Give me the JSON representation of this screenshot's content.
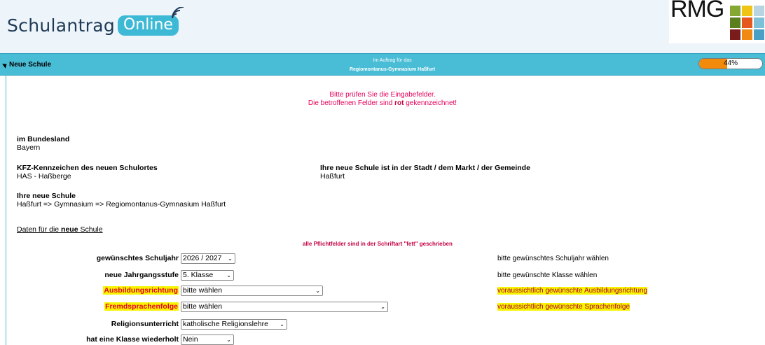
{
  "header": {
    "logo_word": "Schulantrag",
    "logo_pill": "Online",
    "school_logo_text": "RMG",
    "school_logo_colors": [
      "#85a832",
      "#f0c414",
      "#b7d4e0",
      "#5a7f1c",
      "#e55a1c",
      "#7ec0d8",
      "#7a1c1c",
      "#f08a14",
      "#4aa0c4"
    ]
  },
  "nav": {
    "title": "Neue Schule",
    "center_line1": "Im Auftrag für das",
    "center_line2": "Regiomontanus-Gymnasium Haßfurt",
    "progress_percent": 44,
    "progress_label": "44%"
  },
  "alert": {
    "line1": "Bitte prüfen Sie die Eingabefelder.",
    "line2_prefix": "Die betroffenen Felder sind ",
    "line2_bold": "rot",
    "line2_suffix": " gekennzeichnet!"
  },
  "info": {
    "bundesland_label": "im Bundesland",
    "bundesland_value": "Bayern",
    "kfz_label": "KFZ-Kennzeichen des neuen Schulortes",
    "kfz_value": "HAS - Haßberge",
    "stadt_label": "Ihre neue Schule ist in der Stadt / dem Markt / der Gemeinde",
    "stadt_value": "Haßfurt",
    "schule_label": "Ihre neue Schule",
    "schule_value": "Haßfurt => Gymnasium => Regiomontanus-Gymnasium Haßfurt"
  },
  "form": {
    "link_prefix": "Daten für die ",
    "link_bold": "neue",
    "link_suffix": " Schule",
    "pflicht_note": "alle Pflichtfelder sind in der Schriftart \"fett\" geschrieben",
    "rows": [
      {
        "label": "gewünschtes Schuljahr",
        "value": "2026 / 2027",
        "hint": "bitte gewünschtes Schuljahr wählen"
      },
      {
        "label": "neue Jahrgangsstufe",
        "value": "5. Klasse",
        "hint": "bitte gewünschte Klasse wählen"
      },
      {
        "label": "Ausbildungsrichtung",
        "value": "bitte wählen",
        "hint": "voraussichtlich gewünschte Ausbildungsrichtung"
      },
      {
        "label": "Fremdsprachenfolge",
        "value": "bitte wählen",
        "hint": "voraussichtlich gewünschte Sprachenfolge"
      },
      {
        "label": "Religionsunterricht",
        "value": "katholische Religionslehre",
        "hint": ""
      },
      {
        "label": "hat eine Klasse wiederholt",
        "value": "Nein",
        "hint": ""
      }
    ]
  }
}
